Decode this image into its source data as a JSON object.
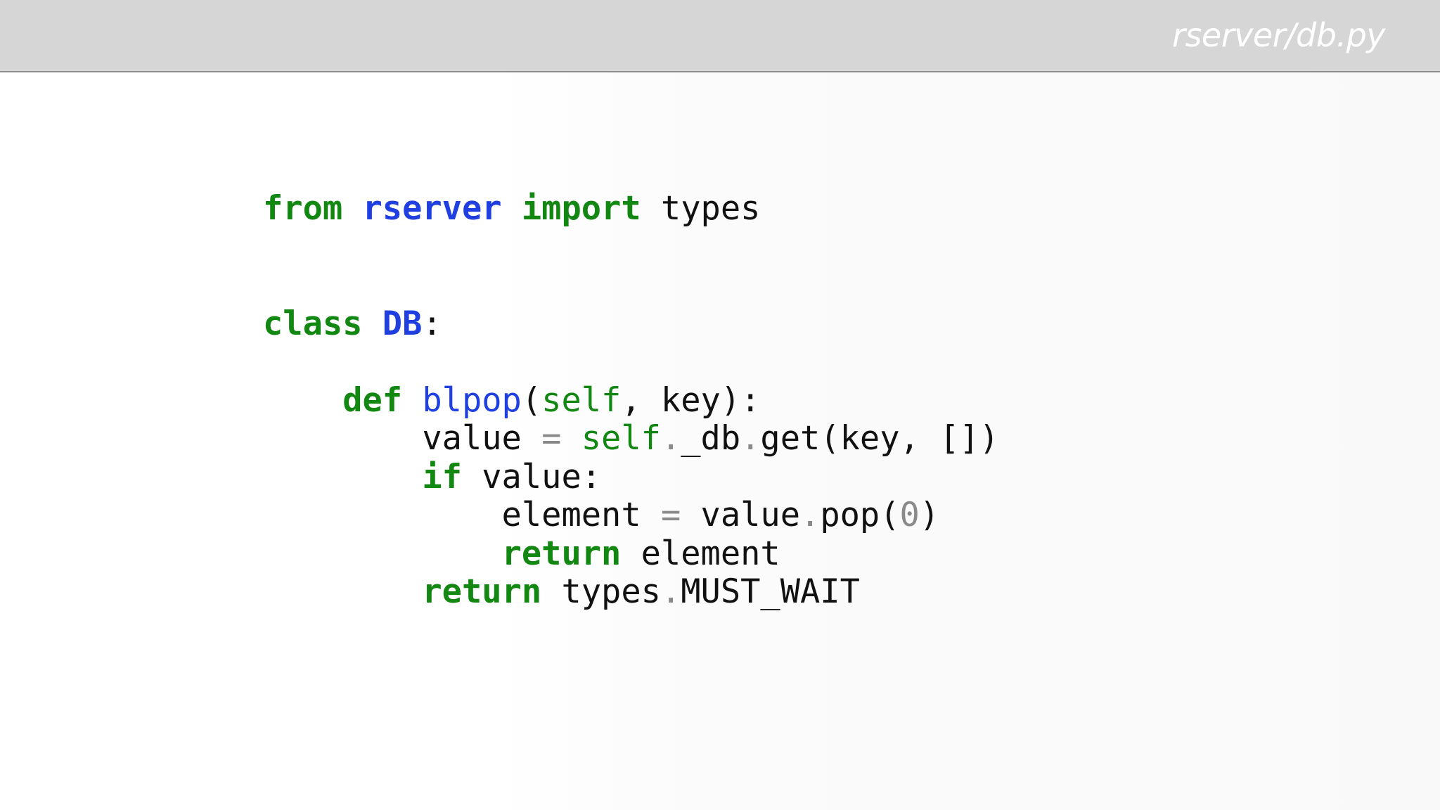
{
  "header": {
    "title": "rserver/db.py"
  },
  "colors": {
    "keyword": "#128712",
    "name": "#1f3fe0",
    "builtin": "#128712",
    "operator": "#8a8a8a",
    "number": "#8a8a8a",
    "text": "#111111",
    "header_bar": "#d6d6d6",
    "header_text": "#ffffff"
  },
  "code": {
    "language": "python",
    "lines": [
      [
        {
          "t": "from",
          "k": "kw"
        },
        {
          "t": " ",
          "k": "id"
        },
        {
          "t": "rserver",
          "k": "ns"
        },
        {
          "t": " ",
          "k": "id"
        },
        {
          "t": "import",
          "k": "kw"
        },
        {
          "t": " types",
          "k": "id"
        }
      ],
      [],
      [],
      [
        {
          "t": "class",
          "k": "kw"
        },
        {
          "t": " ",
          "k": "id"
        },
        {
          "t": "DB",
          "k": "ns"
        },
        {
          "t": ":",
          "k": "id"
        }
      ],
      [],
      [
        {
          "t": "    ",
          "k": "id"
        },
        {
          "t": "def",
          "k": "kw"
        },
        {
          "t": " ",
          "k": "id"
        },
        {
          "t": "blpop",
          "k": "fn"
        },
        {
          "t": "(",
          "k": "id"
        },
        {
          "t": "self",
          "k": "bi"
        },
        {
          "t": ", key):",
          "k": "id"
        }
      ],
      [
        {
          "t": "        value ",
          "k": "id"
        },
        {
          "t": "=",
          "k": "op"
        },
        {
          "t": " ",
          "k": "id"
        },
        {
          "t": "self",
          "k": "bi"
        },
        {
          "t": ".",
          "k": "op"
        },
        {
          "t": "_db",
          "k": "id"
        },
        {
          "t": ".",
          "k": "op"
        },
        {
          "t": "get(key, [])",
          "k": "id"
        }
      ],
      [
        {
          "t": "        ",
          "k": "id"
        },
        {
          "t": "if",
          "k": "kw"
        },
        {
          "t": " value:",
          "k": "id"
        }
      ],
      [
        {
          "t": "            element ",
          "k": "id"
        },
        {
          "t": "=",
          "k": "op"
        },
        {
          "t": " value",
          "k": "id"
        },
        {
          "t": ".",
          "k": "op"
        },
        {
          "t": "pop(",
          "k": "id"
        },
        {
          "t": "0",
          "k": "num"
        },
        {
          "t": ")",
          "k": "id"
        }
      ],
      [
        {
          "t": "            ",
          "k": "id"
        },
        {
          "t": "return",
          "k": "kw"
        },
        {
          "t": " element",
          "k": "id"
        }
      ],
      [
        {
          "t": "        ",
          "k": "id"
        },
        {
          "t": "return",
          "k": "kw"
        },
        {
          "t": " types",
          "k": "id"
        },
        {
          "t": ".",
          "k": "op"
        },
        {
          "t": "MUST_WAIT",
          "k": "id"
        }
      ]
    ]
  }
}
